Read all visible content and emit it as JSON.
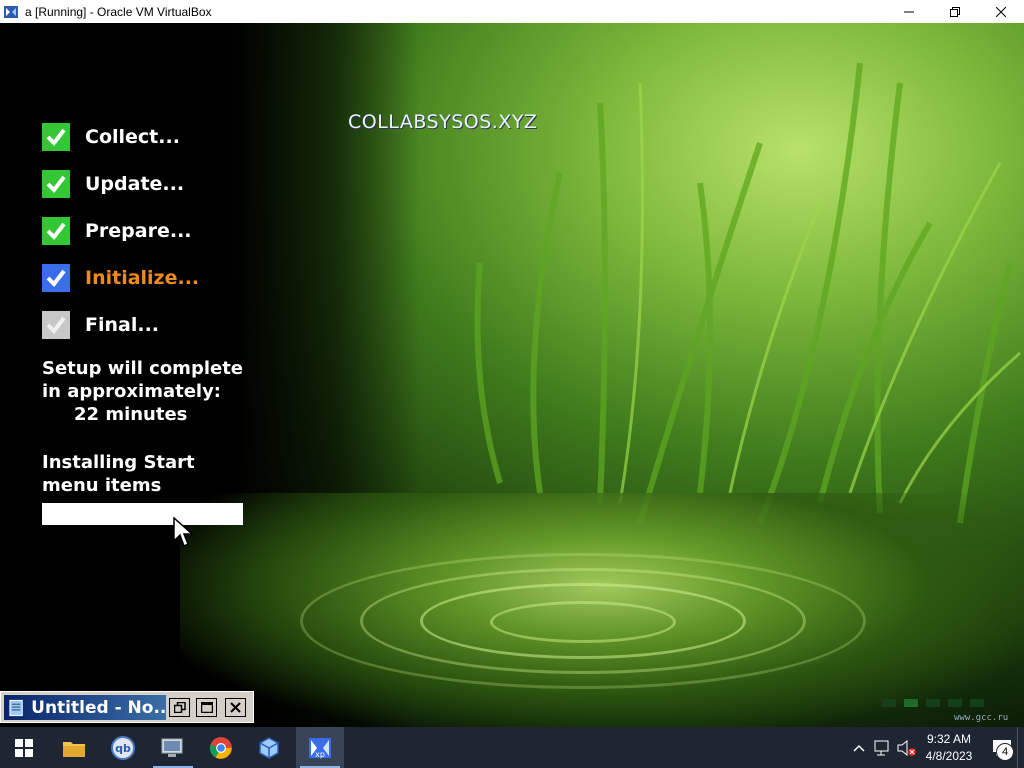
{
  "host_window": {
    "title": "a [Running] - Oracle VM VirtualBox",
    "controls": [
      "minimize-icon",
      "restore-icon",
      "close-icon"
    ]
  },
  "guest": {
    "brand": "COLLABSYSOS.XYZ",
    "steps": [
      {
        "label": "Collect...",
        "state": "done"
      },
      {
        "label": "Update...",
        "state": "done"
      },
      {
        "label": "Prepare...",
        "state": "done"
      },
      {
        "label": "Initialize...",
        "state": "active"
      },
      {
        "label": "Final...",
        "state": "pending"
      }
    ],
    "eta_line1": "Setup will complete",
    "eta_line2": "in approximately:",
    "eta_minutes": "22 minutes",
    "task_line1": "Installing Start",
    "task_line2": "menu items",
    "progress": 0,
    "taskbar_button_label": "Untitled - No...",
    "watermark": "www.gcc.ru",
    "colors": {
      "active_step": "#f08a1c",
      "done_check": "#34c634",
      "active_check": "#3a6ee8"
    }
  },
  "taskbar": {
    "apps": [
      "windows-start-icon",
      "file-explorer-icon",
      "qbittorrent-icon",
      "device-manager-icon",
      "chrome-icon",
      "virtualbox-icon",
      "vm-xp-icon"
    ],
    "clock_time": "9:32 AM",
    "clock_date": "4/8/2023",
    "notification_count": "4"
  }
}
